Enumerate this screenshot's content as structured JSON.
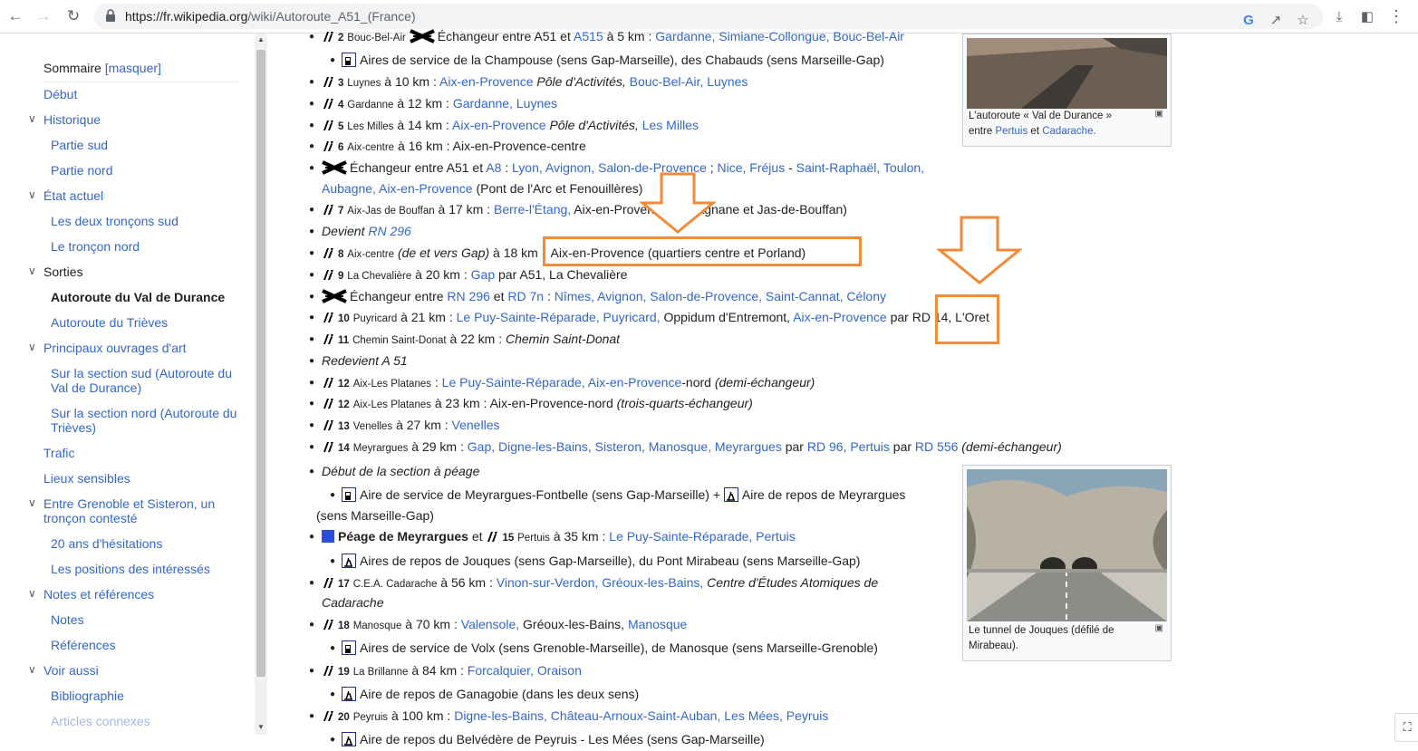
{
  "browser": {
    "url_host": "https://fr.wikipedia.org",
    "url_path": "/wiki/Autoroute_A51_(France)"
  },
  "sidebar": {
    "toc_title": "Sommaire",
    "toc_toggle": "[masquer]",
    "items": [
      {
        "label": "Début",
        "level": 1,
        "chevron": false
      },
      {
        "label": "Historique",
        "level": 1,
        "chevron": true
      },
      {
        "label": "Partie sud",
        "level": 2
      },
      {
        "label": "Partie nord",
        "level": 2
      },
      {
        "label": "État actuel",
        "level": 1,
        "chevron": true
      },
      {
        "label": "Les deux tronçons sud",
        "level": 2
      },
      {
        "label": "Le tronçon nord",
        "level": 2
      },
      {
        "label": "Sorties",
        "level": 1,
        "chevron": true
      },
      {
        "label": "Autoroute du Val de Durance",
        "level": 2,
        "active": true
      },
      {
        "label": "Autoroute du Trièves",
        "level": 2
      },
      {
        "label": "Principaux ouvrages d'art",
        "level": 1,
        "chevron": true
      },
      {
        "label": "Sur la section sud (Autoroute du Val de Durance)",
        "level": 2
      },
      {
        "label": "Sur la section nord (Autoroute du Trièves)",
        "level": 2
      },
      {
        "label": "Trafic",
        "level": 1
      },
      {
        "label": "Lieux sensibles",
        "level": 1
      },
      {
        "label": "Entre Grenoble et Sisteron, un tronçon contesté",
        "level": 1,
        "chevron": true
      },
      {
        "label": "20 ans d'hésitations",
        "level": 2
      },
      {
        "label": "Les positions des intéressés",
        "level": 2
      },
      {
        "label": "Notes et références",
        "level": 1,
        "chevron": true
      },
      {
        "label": "Notes",
        "level": 2
      },
      {
        "label": "Références",
        "level": 2
      },
      {
        "label": "Voir aussi",
        "level": 1,
        "chevron": true
      },
      {
        "label": "Bibliographie",
        "level": 2
      },
      {
        "label": "Articles connexes",
        "level": 2
      }
    ]
  },
  "content": {
    "r1": {
      "num": "2",
      "place": "Bouc-Bel-Air",
      "t1": "Échangeur entre A51 et",
      "l1": "A515",
      "t2": "à 5 km :",
      "l2": "Gardanne, Simiane-Collongue, Bouc-Bel-Air"
    },
    "r2": {
      "text": "Aires de service de la Champouse (sens Gap-Marseille), des Chabauds (sens Marseille-Gap)"
    },
    "r3": {
      "num": "3",
      "place": "Luynes",
      "t1": "à 10 km :",
      "l1": "Aix-en-Provence",
      "i1": "Pôle d'Activités,",
      "l2": "Bouc-Bel-Air, Luynes"
    },
    "r4": {
      "num": "4",
      "place": "Gardanne",
      "t1": "à 12 km :",
      "l1": "Gardanne, Luynes"
    },
    "r5": {
      "num": "5",
      "place": "Les Milles",
      "t1": "à 14 km :",
      "l1": "Aix-en-Provence",
      "i1": "Pôle d'Activités,",
      "l2": "Les Milles"
    },
    "r6": {
      "num": "6",
      "place": "Aix-centre",
      "t1": "à 16 km : Aix-en-Provence-centre"
    },
    "r7": {
      "t1": "Échangeur entre A51 et",
      "l1": "A8",
      "t2": ":",
      "l2": "Lyon, Avignon, Salon-de-Provence",
      "t3": ";",
      "l3": "Nice, Fréjus",
      "t4": "-",
      "l4": "Saint-Raphaël, Toulon,"
    },
    "r7b": {
      "l1": "Aubagne, Aix-en-Provence",
      "t1": "(Pont de l'Arc et Fenouillères)"
    },
    "r8": {
      "num": "7",
      "place": "Aix-Jas de Bouffan",
      "t1": "à 17 km :",
      "l1": "Berre-l'Étang,",
      "t2": "Aix-en-Provence (Encagnane et Jas-de-Bouffan)"
    },
    "r9": {
      "i1": "Devient",
      "l1": "RN 296"
    },
    "r10": {
      "num": "8",
      "place": "Aix-centre",
      "i1": "(de et vers Gap)",
      "t1": "à 18 km :",
      "t2": "Aix-en-Provence (quartiers centre et Porland)"
    },
    "r11": {
      "num": "9",
      "place": "La Chevalière",
      "t1": "à 20 km :",
      "l1": "Gap",
      "t2": "par A51, La Chevalière"
    },
    "r12": {
      "t1": "Échangeur entre",
      "l1": "RN 296",
      "t2": "et",
      "l2": "RD 7n",
      "t3": ":",
      "l3": "Nîmes, Avignon, Salon-de-Provence, Saint-Cannat, Célony"
    },
    "r13": {
      "num": "10",
      "place": "Puyricard",
      "t1": "à 21 km :",
      "l1": "Le Puy-Sainte-Réparade, Puyricard,",
      "t2": "Oppidum d'Entremont,",
      "l2": "Aix-en-Provence",
      "t3": "par RD 14, L'Oret"
    },
    "r14": {
      "num": "11",
      "place": "Chemin Saint-Donat",
      "t1": "à 22 km :",
      "i1": "Chemin Saint-Donat"
    },
    "r15": {
      "i1": "Redevient A 51"
    },
    "r16": {
      "num": "12",
      "place": "Aix-Les Platanes",
      "t1": " :",
      "l1": "Le Puy-Sainte-Réparade, Aix-en-Provence",
      "t2": "-nord",
      "i1": "(demi-échangeur)"
    },
    "r17": {
      "num": "12",
      "place": "Aix-Les Platanes",
      "t1": "à 23 km : Aix-en-Provence-nord",
      "i1": "(trois-quarts-échangeur)"
    },
    "r18": {
      "num": "13",
      "place": "Venelles",
      "t1": "à 27 km :",
      "l1": "Venelles"
    },
    "r19": {
      "num": "14",
      "place": "Meyrargues",
      "t1": "à 29 km :",
      "l1": "Gap, Digne-les-Bains, Sisteron, Manosque, Meyrargues",
      "t2": "par",
      "l2": "RD 96, Pertuis",
      "t3": "par",
      "l3": "RD 556",
      "i1": "(demi-échangeur)"
    },
    "r20": {
      "i1": "Début de la section à péage"
    },
    "r21": {
      "t1": "Aire de service de Meyrargues-Fontbelle (sens Gap-Marseille) +",
      "t2": "Aire de repos de Meyrargues"
    },
    "r21b": {
      "t1": "(sens Marseille-Gap)"
    },
    "r22": {
      "b1": "Péage de Meyrargues",
      "t1": "et",
      "num": "15",
      "place": "Pertuis",
      "t2": "à 35 km :",
      "l1": "Le Puy-Sainte-Réparade, Pertuis"
    },
    "r23": {
      "t1": "Aires de repos de Jouques (sens Gap-Marseille), du Pont Mirabeau (sens Marseille-Gap)"
    },
    "r24": {
      "num": "17",
      "place": "C.E.A. Cadarache",
      "t1": "à 56 km :",
      "l1": "Vinon-sur-Verdon, Gréoux-les-Bains,",
      "i1": "Centre d'Études Atomiques de"
    },
    "r24b": {
      "i1": "Cadarache"
    },
    "r25": {
      "num": "18",
      "place": "Manosque",
      "t1": "à 70 km :",
      "l1": "Valensole,",
      "t2": "Gréoux-les-Bains,",
      "l2": "Manosque"
    },
    "r26": {
      "t1": "Aires de service de Volx (sens Grenoble-Marseille), de Manosque (sens Marseille-Grenoble)"
    },
    "r27": {
      "num": "19",
      "place": "La Brillanne",
      "t1": "à 84 km :",
      "l1": "Forcalquier, Oraison"
    },
    "r28": {
      "t1": "Aire de repos de Ganagobie (dans les deux sens)"
    },
    "r29": {
      "num": "20",
      "place": "Peyruis",
      "t1": "à 100 km :",
      "l1": "Digne-les-Bains, Château-Arnoux-Saint-Auban, Les Mées, Peyruis"
    },
    "r30": {
      "t1": "Aire de repos du Belvédère de Peyruis - Les Mées (sens Gap-Marseille)"
    }
  },
  "figures": {
    "fig1": {
      "cap1": "L'autoroute « Val de Durance »",
      "cap2a": "entre",
      "cap2b": "Pertuis",
      "cap2c": "et",
      "cap2d": "Cadarache."
    },
    "fig2": {
      "cap1": "Le tunnel de Jouques (défilé de",
      "cap2": "Mirabeau)."
    }
  },
  "colors": {
    "link": "#3366cc",
    "annotation": "#f28a3a"
  }
}
